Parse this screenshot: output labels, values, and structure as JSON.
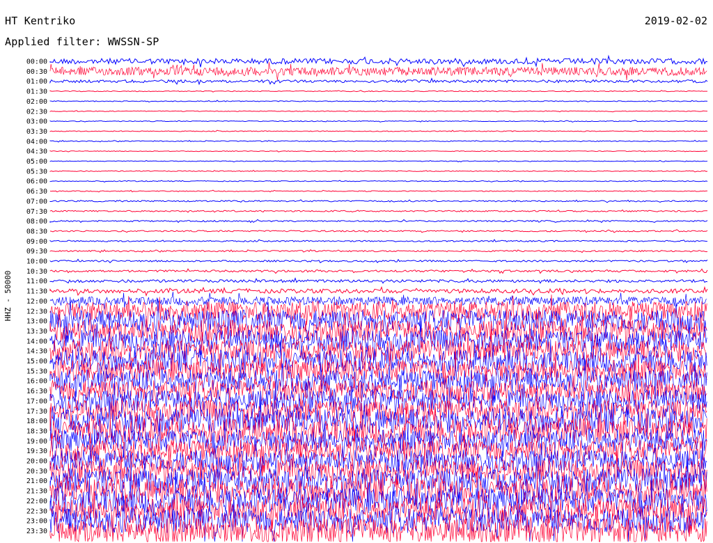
{
  "header": {
    "station": "HT Kentriko",
    "date": "2019-02-02",
    "filter": "Applied filter: WWSSN-SP"
  },
  "chart_data": {
    "type": "line",
    "title": "HT Kentriko",
    "ylabel": "HHZ - 50000",
    "colors": {
      "even": "#0000ff",
      "odd": "#ff0033"
    },
    "rows": [
      {
        "t": "00:00",
        "a": 4
      },
      {
        "t": "00:30",
        "a": 6
      },
      {
        "t": "01:00",
        "a": 2
      },
      {
        "t": "01:30",
        "a": 0.6
      },
      {
        "t": "02:00",
        "a": 0.6
      },
      {
        "t": "02:30",
        "a": 0.5
      },
      {
        "t": "03:00",
        "a": 0.6
      },
      {
        "t": "03:30",
        "a": 0.6
      },
      {
        "t": "04:00",
        "a": 0.6
      },
      {
        "t": "04:30",
        "a": 0.5
      },
      {
        "t": "05:00",
        "a": 0.5
      },
      {
        "t": "05:30",
        "a": 0.6
      },
      {
        "t": "06:00",
        "a": 0.6
      },
      {
        "t": "06:30",
        "a": 0.6
      },
      {
        "t": "07:00",
        "a": 1
      },
      {
        "t": "07:30",
        "a": 1
      },
      {
        "t": "08:00",
        "a": 1
      },
      {
        "t": "08:30",
        "a": 1
      },
      {
        "t": "09:00",
        "a": 1
      },
      {
        "t": "09:30",
        "a": 1
      },
      {
        "t": "10:00",
        "a": 1.2
      },
      {
        "t": "10:30",
        "a": 1.5
      },
      {
        "t": "11:00",
        "a": 2
      },
      {
        "t": "11:30",
        "a": 3
      },
      {
        "t": "12:00",
        "a": 6
      },
      {
        "t": "12:30",
        "a": 14
      },
      {
        "t": "13:00",
        "a": 16
      },
      {
        "t": "13:30",
        "a": 16
      },
      {
        "t": "14:00",
        "a": 16
      },
      {
        "t": "14:30",
        "a": 16
      },
      {
        "t": "15:00",
        "a": 16
      },
      {
        "t": "15:30",
        "a": 16
      },
      {
        "t": "16:00",
        "a": 16
      },
      {
        "t": "16:30",
        "a": 16
      },
      {
        "t": "17:00",
        "a": 16
      },
      {
        "t": "17:30",
        "a": 16
      },
      {
        "t": "18:00",
        "a": 18
      },
      {
        "t": "18:30",
        "a": 18
      },
      {
        "t": "19:00",
        "a": 16
      },
      {
        "t": "19:30",
        "a": 16
      },
      {
        "t": "20:00",
        "a": 16
      },
      {
        "t": "20:30",
        "a": 16
      },
      {
        "t": "21:00",
        "a": 18
      },
      {
        "t": "21:30",
        "a": 18
      },
      {
        "t": "22:00",
        "a": 18
      },
      {
        "t": "22:30",
        "a": 18
      },
      {
        "t": "23:00",
        "a": 18
      },
      {
        "t": "23:30",
        "a": 18
      }
    ]
  }
}
